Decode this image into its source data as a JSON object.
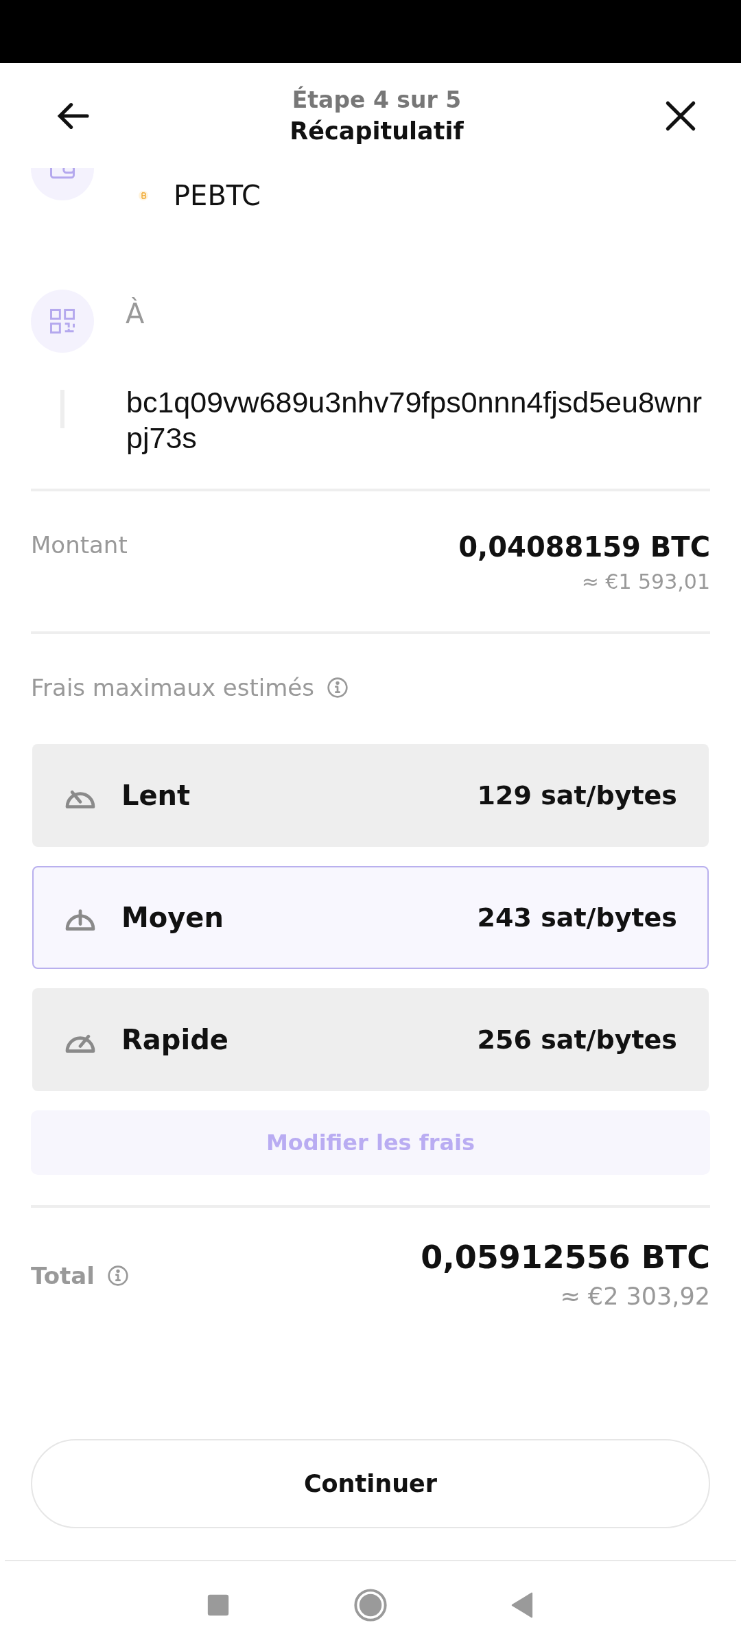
{
  "header": {
    "step": "Étape 4 sur 5",
    "title": "Récapitulatif"
  },
  "from": {
    "account": "PEBTC"
  },
  "to": {
    "label": "À",
    "address": "bc1q09vw689u3nhv79fps0nnn4fjsd5eu8wnrpj73s"
  },
  "amount": {
    "label": "Montant",
    "value": "0,04088159 BTC",
    "fiat": "≈ €1 593,01"
  },
  "fees": {
    "label": "Frais maximaux estimés",
    "options": [
      {
        "kind": "slow",
        "name": "Lent",
        "rate": "129 sat/bytes",
        "selected": false
      },
      {
        "kind": "medium",
        "name": "Moyen",
        "rate": "243 sat/bytes",
        "selected": true
      },
      {
        "kind": "fast",
        "name": "Rapide",
        "rate": "256 sat/bytes",
        "selected": false
      }
    ],
    "edit_button": "Modifier les frais"
  },
  "total": {
    "label": "Total",
    "value": "0,05912556 BTC",
    "fiat": "≈ €2 303,92"
  },
  "continue_button": "Continuer"
}
